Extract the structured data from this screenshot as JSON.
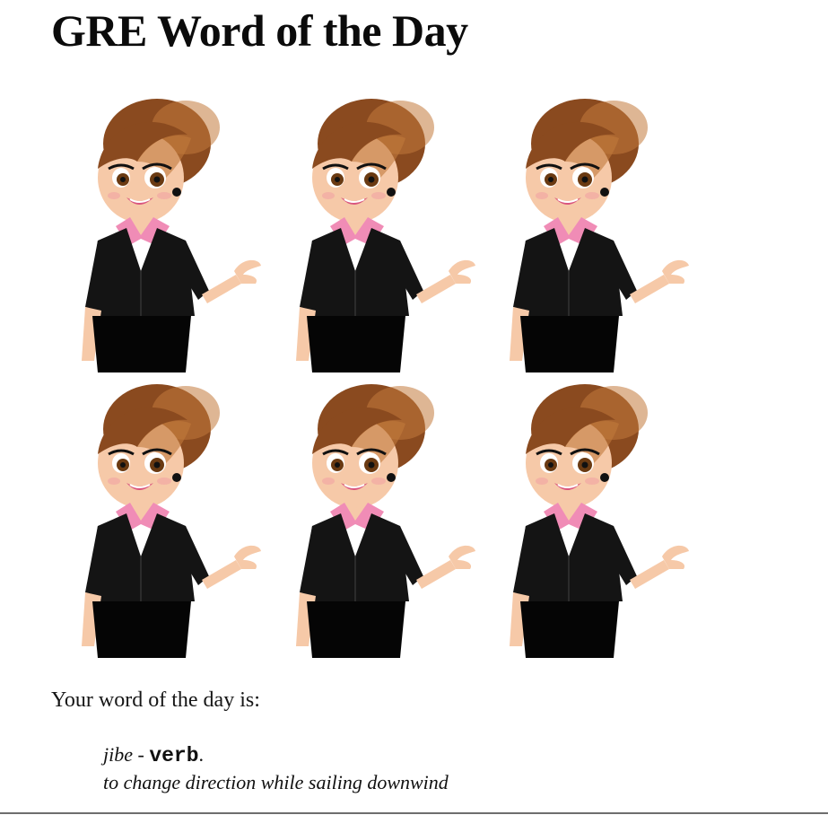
{
  "page": {
    "title": "GRE Word of the Day"
  },
  "illustrations": {
    "count": 6,
    "columns": 3,
    "icon": "cartoon-businesswoman-presenting-illustration",
    "colors": {
      "hair": "#8a4a1f",
      "hair_highlight": "#c27a3c",
      "skin": "#f6c9a8",
      "jacket": "#141414",
      "collar": "#f08cb6",
      "lips": "#d9557e",
      "eyes": "#6a3a12"
    }
  },
  "word_of_day": {
    "intro": "Your word of the day is:",
    "word": "jibe",
    "separator": " - ",
    "part_of_speech": "verb",
    "pos_suffix": ".",
    "definition": "to change direction while sailing downwind"
  }
}
